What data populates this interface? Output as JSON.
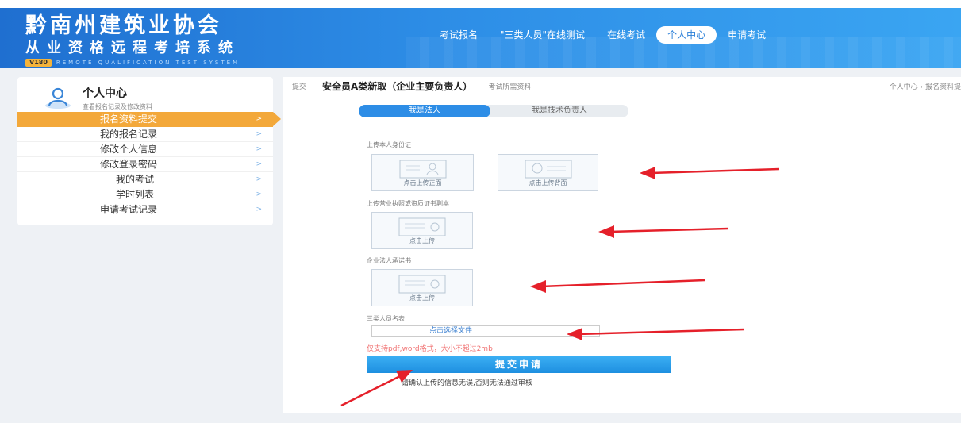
{
  "header": {
    "title": "黔南州建筑业协会",
    "subtitle": "从业资格远程考培系统",
    "version": "V180",
    "english": "REMOTE QUALIFICATION TEST SYSTEM",
    "nav": [
      "考试报名",
      "\"三类人员\"在线测试",
      "在线考试",
      "个人中心",
      "申请考试"
    ],
    "active_nav": "个人中心"
  },
  "sidebar": {
    "title": "个人中心",
    "desc": "查看报名记录及修改资料",
    "items": [
      "报名资料提交",
      "我的报名记录",
      "修改个人信息",
      "修改登录密码",
      "我的考试",
      "学时列表",
      "申请考试记录"
    ],
    "active_item": "报名资料提交"
  },
  "main": {
    "crumb_label": "提交",
    "title": "安全员A类新取（企业主要负责人）",
    "tag": "考试所需资料",
    "path": "个人中心 › 报名资料提",
    "tabs": [
      "我是法人",
      "我是技术负责人"
    ],
    "sections": {
      "id_card": "上传本人身份证",
      "license": "上传营业执照或资质证书副本",
      "commitment": "企业法人承诺书",
      "roster": "三类人员名表"
    },
    "upload": {
      "front": "点击上传正面",
      "back": "点击上传背面",
      "generic": "点击上传"
    },
    "file_placeholder": "点击选择文件",
    "hint": "仅支持pdf,word格式，大小不超过2mb",
    "submit": "提交申请",
    "note": "请确认上传的信息无误,否则无法通过审核"
  },
  "colors": {
    "header_start": "#1f6fd0",
    "header_end": "#3aa5f2",
    "accent": "#2d8de6",
    "active_menu": "#f3a83a",
    "arrow": "#e5202a"
  }
}
